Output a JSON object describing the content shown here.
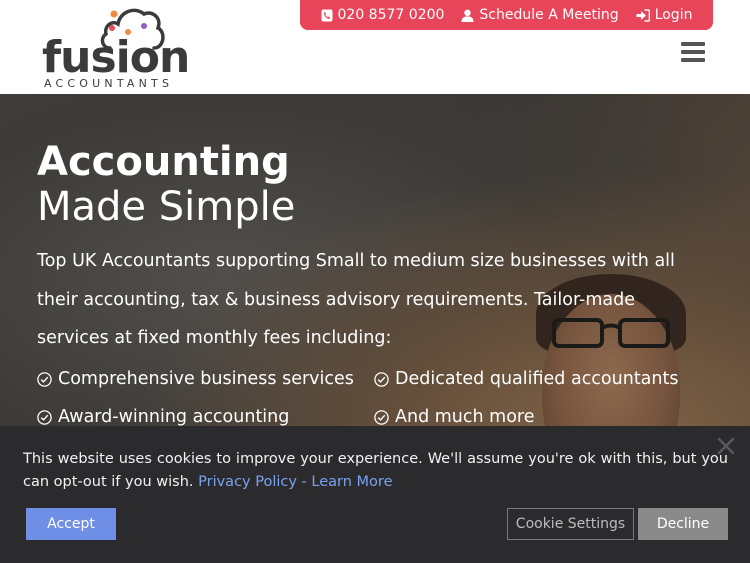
{
  "header": {
    "logo": {
      "word": "fusion",
      "sub": "ACCOUNTANTS"
    },
    "topbar": {
      "phone": "020 8577 0200",
      "meeting": "Schedule A Meeting",
      "login": "Login"
    },
    "colors": {
      "accent": "#e8445a",
      "cloud_orange": "#f08a3c",
      "cloud_red": "#e8445a",
      "cloud_purple": "#8f5fc5"
    }
  },
  "hero": {
    "title_bold": "Accounting",
    "title_light": "Made Simple",
    "description": "Top UK Accountants supporting Small to medium size businesses with all their accounting, tax & business advisory requirements. Tailor-made services at fixed monthly fees including:",
    "features": [
      "Comprehensive business services",
      "Dedicated qualified accountants",
      "Award-winning accounting",
      "And much more"
    ]
  },
  "cookie": {
    "text": "This website uses cookies to improve your experience. We'll assume you're ok with this, but you can opt-out if you wish.",
    "link_privacy": "Privacy Policy",
    "link_sep": " - ",
    "link_learn": "Learn More",
    "accept": "Accept",
    "settings": "Cookie Settings",
    "decline": "Decline"
  }
}
